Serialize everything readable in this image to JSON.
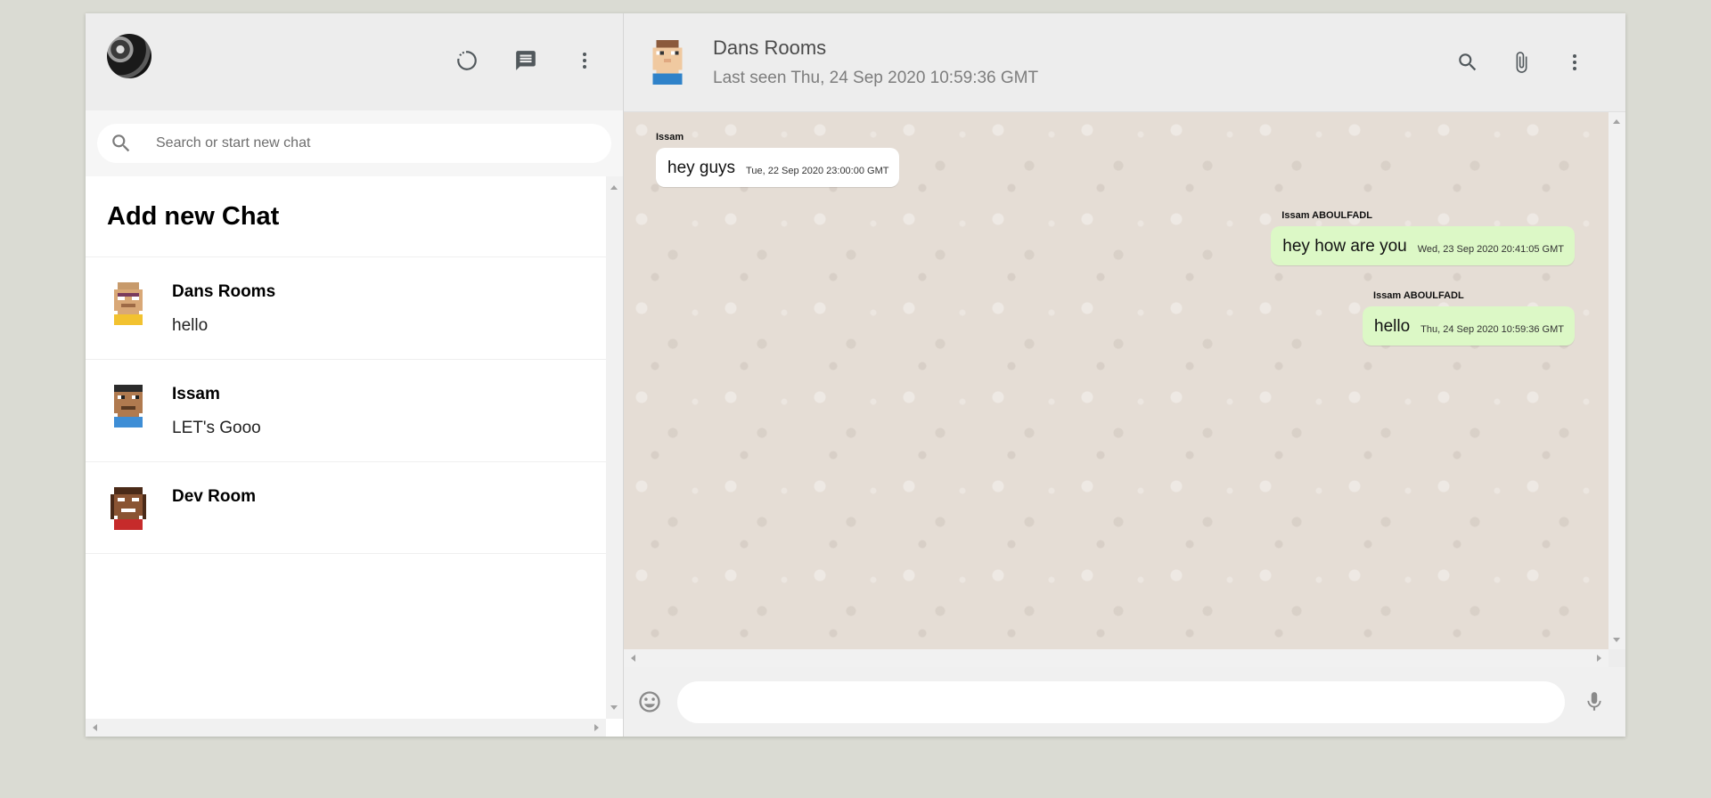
{
  "sidebar": {
    "search": {
      "placeholder": "Search or start new chat"
    },
    "add_new_chat": "Add new Chat",
    "chats": [
      {
        "name": "Dans Rooms",
        "last_message": "hello",
        "avatar": "pixel-avatar-dans"
      },
      {
        "name": "Issam",
        "last_message": "LET's Gooo",
        "avatar": "pixel-avatar-issam"
      },
      {
        "name": "Dev Room",
        "last_message": "",
        "avatar": "pixel-avatar-dev"
      }
    ],
    "icons": [
      "status-icon",
      "new-chat-icon",
      "more-vert-icon",
      "search-icon"
    ]
  },
  "chat": {
    "room_name": "Dans Rooms",
    "last_seen": "Last seen Thu, 24 Sep 2020 10:59:36 GMT",
    "messages": [
      {
        "sender": "Issam",
        "text": "hey guys",
        "time": "Tue, 22 Sep 2020 23:00:00 GMT",
        "outgoing": false
      },
      {
        "sender": "Issam ABOULFADL",
        "text": "hey how are you",
        "time": "Wed, 23 Sep 2020 20:41:05 GMT",
        "outgoing": true
      },
      {
        "sender": "Issam ABOULFADL",
        "text": "hello",
        "time": "Thu, 24 Sep 2020 10:59:36 GMT",
        "outgoing": true
      }
    ],
    "input_value": "",
    "icons": [
      "search-icon",
      "attach-icon",
      "more-vert-icon",
      "emoji-icon",
      "mic-icon"
    ]
  },
  "colors": {
    "page_bg": "#dadbd3",
    "header_bg": "#ededed",
    "incoming_bubble": "#ffffff",
    "outgoing_bubble": "#dcf8c6",
    "chat_bg": "#e5ddd5"
  }
}
